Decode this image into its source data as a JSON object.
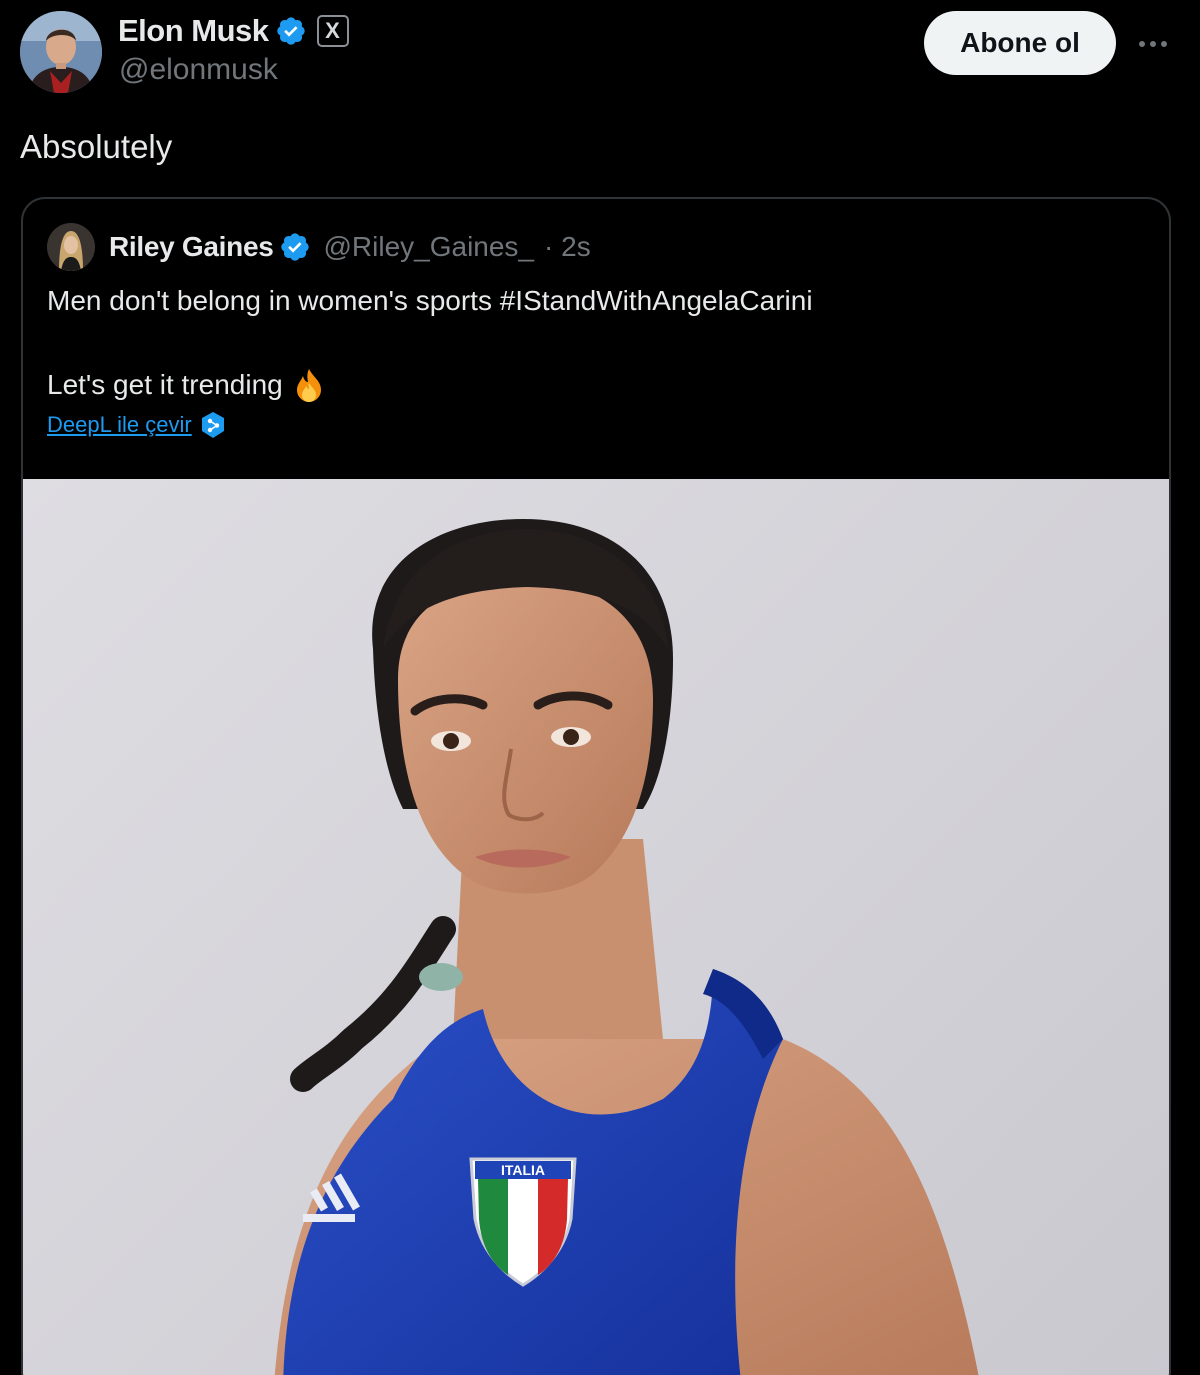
{
  "author": {
    "display_name": "Elon Musk",
    "handle": "@elonmusk",
    "verified_icon": "verified-badge-icon",
    "affiliation_icon": "x-logo-icon",
    "affiliation_glyph": "X"
  },
  "actions": {
    "follow_label": "Abone ol",
    "more_icon": "more-icon"
  },
  "post": {
    "text": "Absolutely"
  },
  "quoted": {
    "display_name": "Riley Gaines",
    "handle": "@Riley_Gaines_",
    "time": "· 2s",
    "line1": "Men don't belong in women's sports #IStandWithAngelaCarini",
    "line2": "Let's get it trending",
    "emoji_icon": "fire-icon",
    "translate_label": "DeepL ile çevir",
    "translate_icon": "deepl-icon",
    "image_alt": "",
    "jersey_text": "ITALIA"
  },
  "colors": {
    "background": "#000000",
    "text": "#e7e9ea",
    "secondary": "#71767b",
    "link": "#1d9bf0",
    "border": "#2f3336",
    "jersey": "#1f44b8"
  }
}
